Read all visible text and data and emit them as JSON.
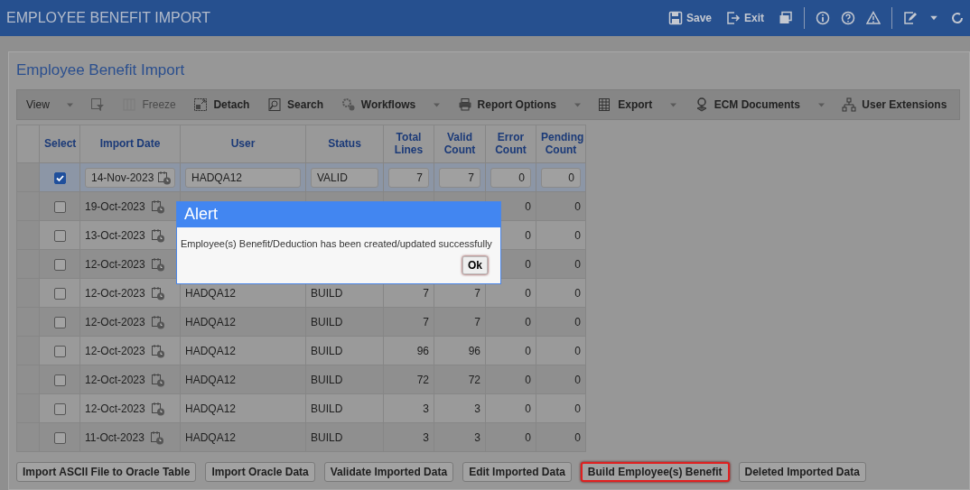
{
  "window": {
    "title": "EMPLOYEE BENEFIT IMPORT"
  },
  "header_actions": [
    {
      "label": "Save"
    },
    {
      "label": "Exit"
    }
  ],
  "page_title": "Employee Benefit Import",
  "toolbar": [
    {
      "label": "View",
      "dropdown": true,
      "disabled": false
    },
    {
      "label": "Freeze",
      "dropdown": false,
      "disabled": true
    },
    {
      "label": "Detach",
      "dropdown": false,
      "disabled": false
    },
    {
      "label": "Search",
      "dropdown": false,
      "disabled": false
    },
    {
      "label": "Workflows",
      "dropdown": true,
      "disabled": false
    },
    {
      "label": "Report Options",
      "dropdown": true,
      "disabled": false
    },
    {
      "label": "Export",
      "dropdown": true,
      "disabled": false
    },
    {
      "label": "ECM Documents",
      "dropdown": true,
      "disabled": false
    },
    {
      "label": "User Extensions",
      "dropdown": false,
      "disabled": false
    }
  ],
  "table": {
    "columns": [
      "Select",
      "Import Date",
      "User",
      "Status",
      "Total Lines",
      "Valid Count",
      "Error Count",
      "Pending Count"
    ],
    "rows": [
      {
        "selected": true,
        "editing": true,
        "date": "14-Nov-2023",
        "user": "HADQA12",
        "status": "VALID",
        "total": "7",
        "valid": "7",
        "error": "0",
        "pending": "0"
      },
      {
        "selected": false,
        "editing": false,
        "date": "19-Oct-2023",
        "error": "0",
        "pending": "0"
      },
      {
        "selected": false,
        "editing": false,
        "date": "13-Oct-2023",
        "error": "0",
        "pending": "0"
      },
      {
        "selected": false,
        "editing": false,
        "date": "12-Oct-2023",
        "error": "0",
        "pending": "0"
      },
      {
        "selected": false,
        "editing": false,
        "date": "12-Oct-2023",
        "user": "HADQA12",
        "status": "BUILD",
        "total": "7",
        "valid": "7",
        "error": "0",
        "pending": "0"
      },
      {
        "selected": false,
        "editing": false,
        "date": "12-Oct-2023",
        "user": "HADQA12",
        "status": "BUILD",
        "total": "7",
        "valid": "7",
        "error": "0",
        "pending": "0"
      },
      {
        "selected": false,
        "editing": false,
        "date": "12-Oct-2023",
        "user": "HADQA12",
        "status": "BUILD",
        "total": "96",
        "valid": "96",
        "error": "0",
        "pending": "0"
      },
      {
        "selected": false,
        "editing": false,
        "date": "12-Oct-2023",
        "user": "HADQA12",
        "status": "BUILD",
        "total": "72",
        "valid": "72",
        "error": "0",
        "pending": "0"
      },
      {
        "selected": false,
        "editing": false,
        "date": "12-Oct-2023",
        "user": "HADQA12",
        "status": "BUILD",
        "total": "3",
        "valid": "3",
        "error": "0",
        "pending": "0"
      },
      {
        "selected": false,
        "editing": false,
        "date": "11-Oct-2023",
        "user": "HADQA12",
        "status": "BUILD",
        "total": "3",
        "valid": "3",
        "error": "0",
        "pending": "0"
      }
    ]
  },
  "buttons": [
    {
      "label": "Import ASCII File to Oracle Table",
      "highlighted": false
    },
    {
      "label": "Import Oracle Data",
      "highlighted": false
    },
    {
      "label": "Validate Imported Data",
      "highlighted": false
    },
    {
      "label": "Edit Imported Data",
      "highlighted": false
    },
    {
      "label": "Build Employee(s) Benefit",
      "highlighted": true
    },
    {
      "label": "Deleted Imported Data",
      "highlighted": false
    }
  ],
  "dialog": {
    "title": "Alert",
    "message": "Employee(s) Benefit/Deduction has been created/updated successfully",
    "button": {
      "label": "Ok",
      "highlighted": true
    }
  }
}
